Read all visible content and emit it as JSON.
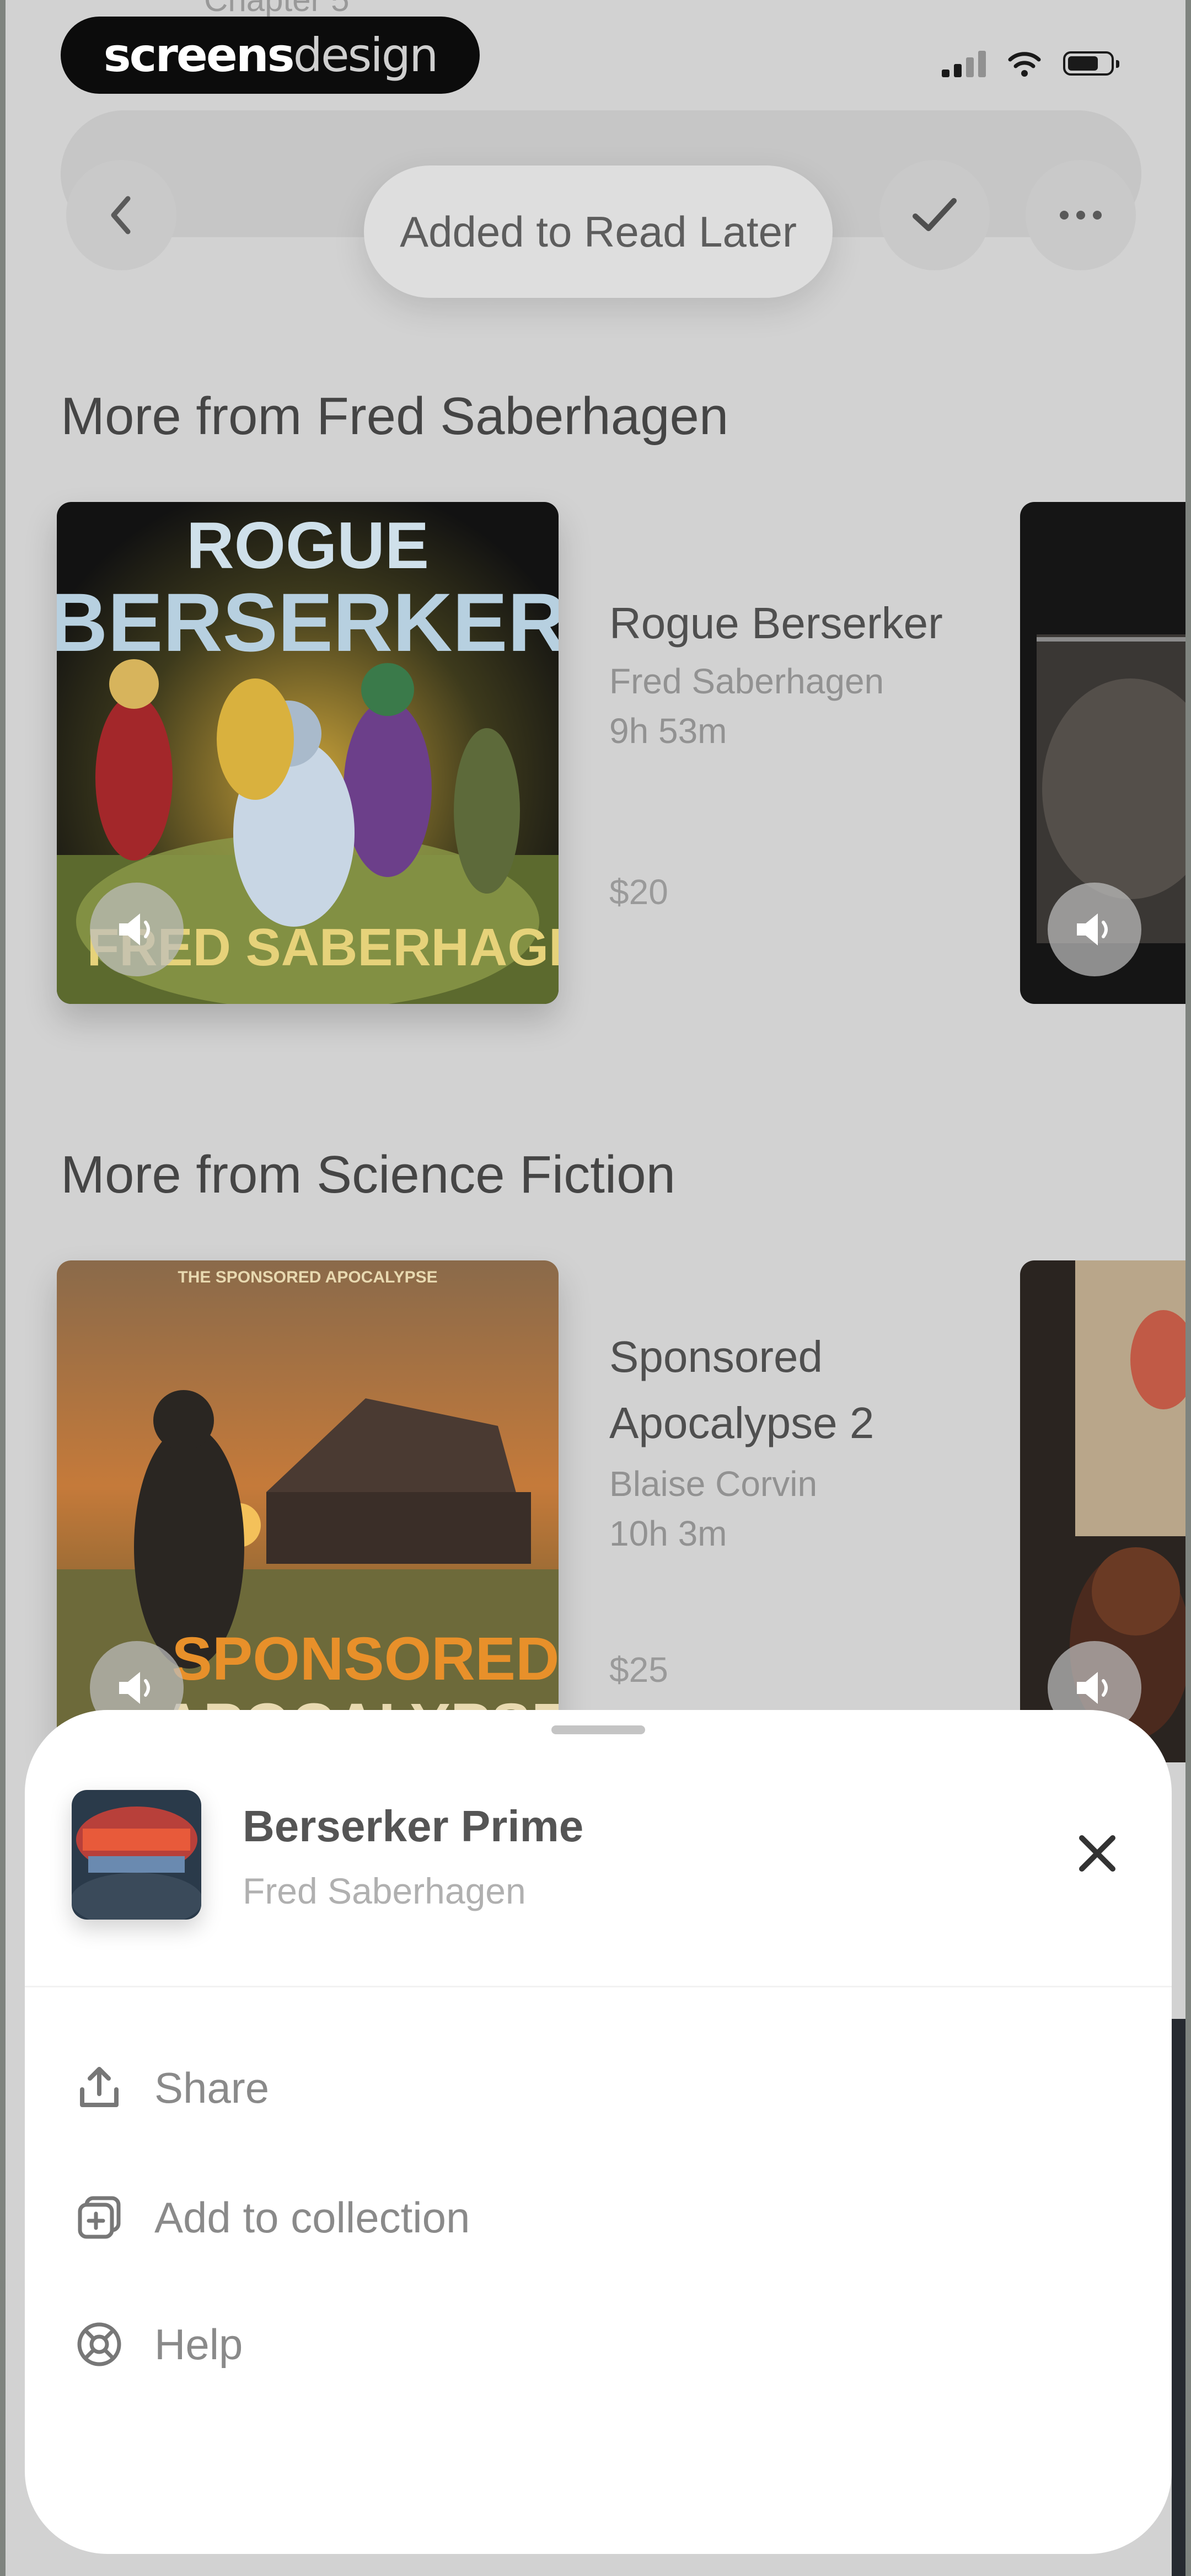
{
  "status_bar": {
    "watermark_bold": "screens",
    "watermark_thin": "design",
    "top_ghost_text": "Chapter 5"
  },
  "nav": {
    "back_icon": "chevron-left-icon",
    "check_icon": "checkmark-icon",
    "more_icon": "ellipsis-icon"
  },
  "toast": {
    "text": "Added to Read Later"
  },
  "sections": [
    {
      "title": "More from Fred Saberhagen",
      "book": {
        "cover_title_line1": "ROGUE",
        "cover_title_line2": "BERSERKER",
        "cover_author": "FRED SABERHAGEN",
        "title": "Rogue Berserker",
        "author": "Fred Saberhagen",
        "duration": "9h 53m",
        "price": "$20"
      }
    },
    {
      "title": "More from Science Fiction",
      "book": {
        "cover_series": "THE SPONSORED APOCALYPSE",
        "cover_title_line1": "SPONSORED",
        "cover_title_line2": "APOCALYPSE",
        "title_line1": "Sponsored",
        "title_line2": "Apocalypse 2",
        "author": "Blaise Corvin",
        "duration": "10h 3m",
        "price": "$25"
      }
    }
  ],
  "sheet": {
    "title": "Berserker Prime",
    "author": "Fred Saberhagen",
    "menu": [
      {
        "label": "Share",
        "icon": "share-icon"
      },
      {
        "label": "Add to collection",
        "icon": "add-to-collection-icon"
      },
      {
        "label": "Help",
        "icon": "help-icon"
      }
    ]
  },
  "colors": {
    "dim_overlay_bg": "#d2d2d2",
    "sheet_bg": "#ffffff",
    "text_dark": "#454545",
    "text_muted": "#929292"
  }
}
